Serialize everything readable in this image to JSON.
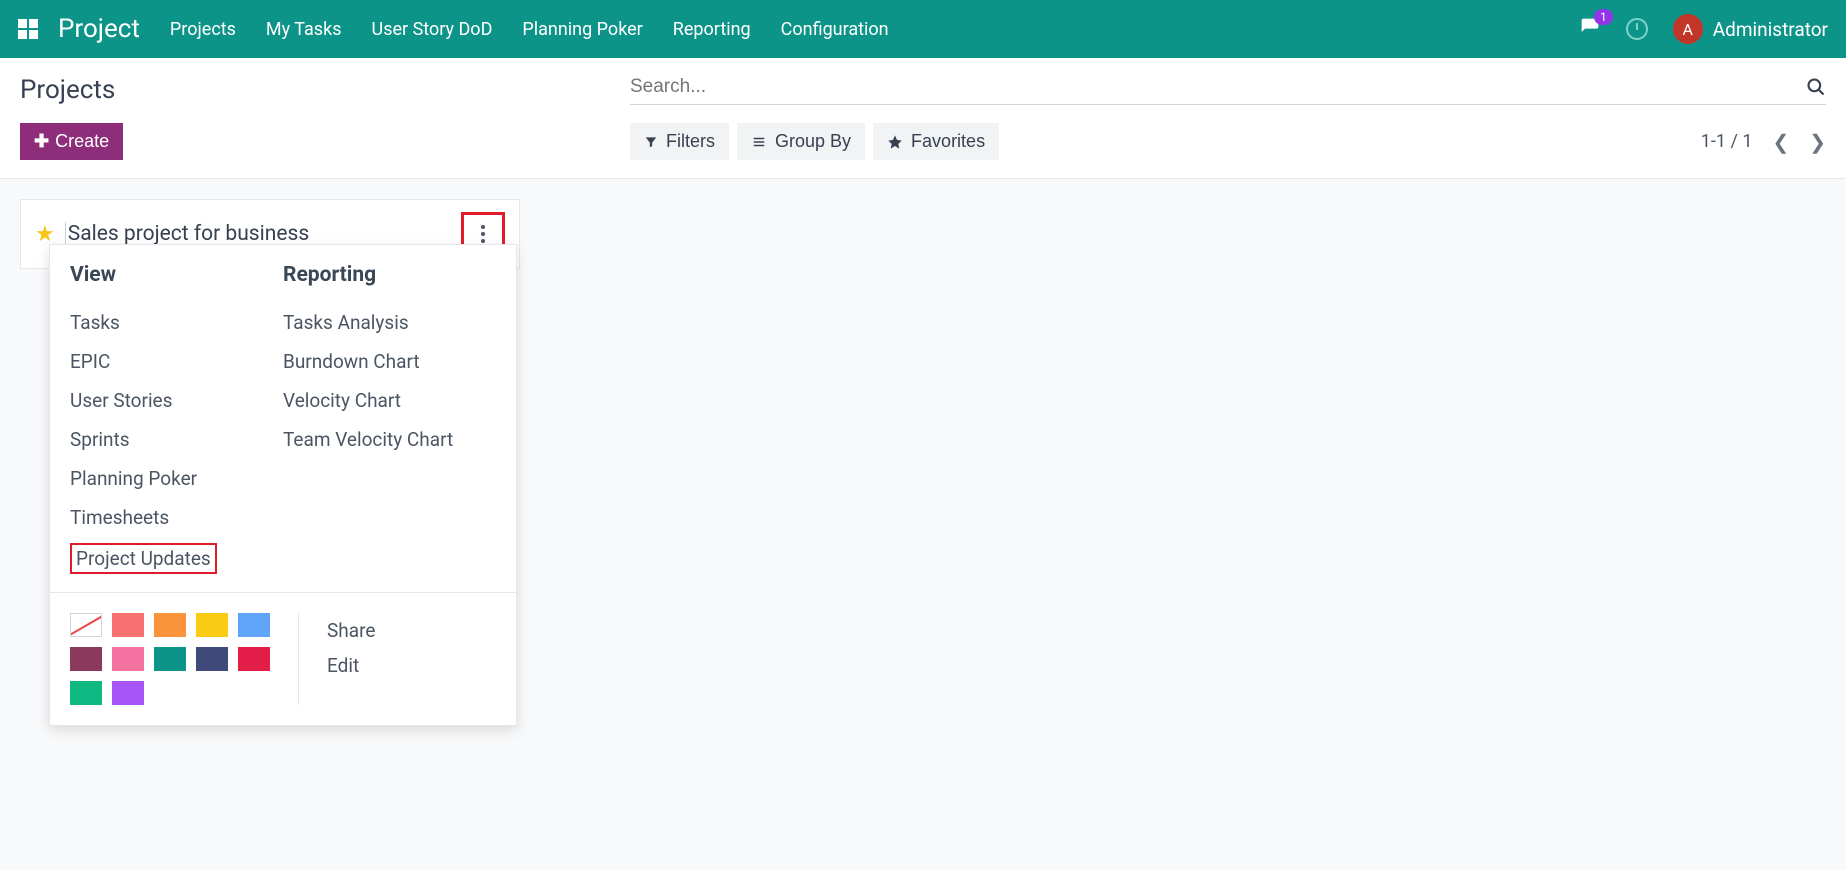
{
  "navbar": {
    "brand": "Project",
    "items": [
      "Projects",
      "My Tasks",
      "User Story DoD",
      "Planning Poker",
      "Reporting",
      "Configuration"
    ],
    "badge_count": "1",
    "avatar_initial": "A",
    "username": "Administrator"
  },
  "control": {
    "page_title": "Projects",
    "create_label": "Create",
    "search_placeholder": "Search...",
    "filters_label": "Filters",
    "groupby_label": "Group By",
    "favorites_label": "Favorites",
    "pager": "1-1 / 1"
  },
  "card": {
    "title": "Sales project for business"
  },
  "dropdown": {
    "view_head": "View",
    "reporting_head": "Reporting",
    "view_items": [
      "Tasks",
      "EPIC",
      "User Stories",
      "Sprints",
      "Planning Poker",
      "Timesheets",
      "Project Updates"
    ],
    "reporting_items": [
      "Tasks Analysis",
      "Burndown Chart",
      "Velocity Chart",
      "Team Velocity Chart"
    ],
    "colors": [
      "none",
      "#f87171",
      "#fb923c",
      "#facc15",
      "#60a5fa",
      "#8b3a5e",
      "#f472a0",
      "#0d9488",
      "#3f4a7a",
      "#e11d48",
      "#10b981",
      "#a855f7"
    ],
    "share_label": "Share",
    "edit_label": "Edit"
  }
}
